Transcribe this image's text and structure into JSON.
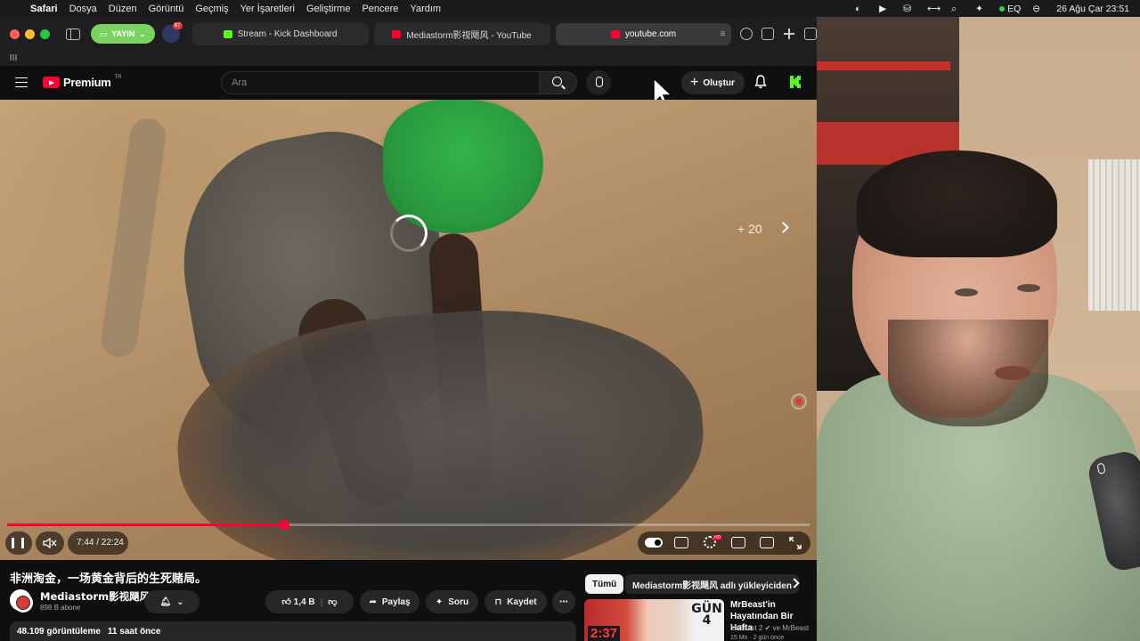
{
  "menubar": {
    "app": "Safari",
    "items": [
      "Dosya",
      "Düzen",
      "Görüntü",
      "Geçmiş",
      "Yer İşaretleri",
      "Geliştirme",
      "Pencere",
      "Yardım"
    ],
    "eq_label": "EQ",
    "datetime": "26 Ağu Çar  23:51"
  },
  "toolbar": {
    "yayin_label": "YAYIN",
    "ext_badge": "67",
    "tabs": [
      {
        "title": "Stream - Kick Dashboard",
        "favicon": "kick-icon"
      },
      {
        "title": "Mediastorm影视飓风 - YouTube",
        "favicon": "youtube-icon"
      },
      {
        "title": "youtube.com",
        "favicon": "youtube-icon",
        "active": true
      }
    ]
  },
  "youtube": {
    "logo_word": "Premium",
    "logo_country": "TR",
    "search_placeholder": "Ara",
    "create_label": "Oluştur"
  },
  "player": {
    "skip_label": "+ 20",
    "current_time": "7:44",
    "duration": "22:24",
    "time_display": "7:44 / 22:24",
    "progress_fraction": 0.345,
    "hd_badge": "HD",
    "accent": "#ff0033"
  },
  "video": {
    "title": "非洲淘金，一场黄金背后的生死赌局。",
    "channel": "Mediastorm影视飓风",
    "subscribers": "898 B abone",
    "likes": "1,4 B",
    "share_label": "Paylaş",
    "ask_label": "Soru",
    "save_label": "Kaydet",
    "views": "48.109 görüntüleme",
    "uploaded": "11 saat önce"
  },
  "sidebar": {
    "chips": [
      "Tümü",
      "Mediastorm影视飓风 adlı yükleyiciden"
    ],
    "recommendation": {
      "title": "MrBeast'in Hayatından Bir Hafta",
      "meta": "MrBeast 2 ✔ ve MrBeast",
      "meta2": "15 Mn · 2 gün önce",
      "thumb_text": "GÜN 4",
      "thumb_clock": "2:37"
    }
  }
}
